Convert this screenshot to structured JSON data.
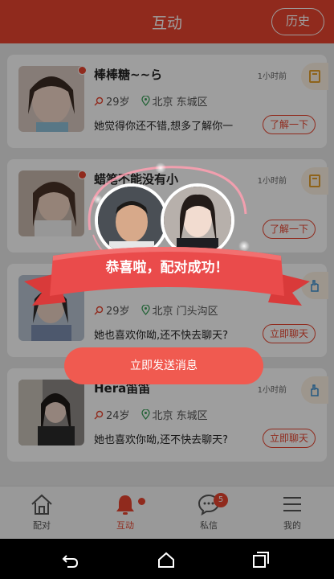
{
  "header": {
    "title": "互动",
    "history_label": "历史"
  },
  "cards": [
    {
      "name": "棒棒糖~~ら",
      "time": "1小时前",
      "age": "29岁",
      "location": "北京 东城区",
      "message": "她觉得你还不错,想多了解你一",
      "action": "了解一下",
      "side_icon": "book-icon"
    },
    {
      "name": "蜡笔不能没有小",
      "time": "1小时前",
      "age": "",
      "location": "",
      "message": "",
      "action": "了解一下",
      "side_icon": "book-icon"
    },
    {
      "name": "",
      "time": "",
      "age": "29岁",
      "location": "北京 门头沟区",
      "message": "她也喜欢你呦,还不快去聊天?",
      "action": "立即聊天",
      "side_icon": "hand-icon"
    },
    {
      "name": "Hera笛笛",
      "time": "1小时前",
      "age": "24岁",
      "location": "北京 东城区",
      "message": "她也喜欢你呦,还不快去聊天?",
      "action": "立即聊天",
      "side_icon": "hand-icon"
    }
  ],
  "popup": {
    "ribbon_text": "恭喜啦，配对成功！",
    "send_label": "立即发送消息"
  },
  "tabs": [
    {
      "label": "配对",
      "icon": "home-icon"
    },
    {
      "label": "互动",
      "icon": "bell-icon"
    },
    {
      "label": "私信",
      "icon": "chat-icon",
      "badge": "5"
    },
    {
      "label": "我的",
      "icon": "menu-icon"
    }
  ],
  "colors": {
    "accent": "#e8452f",
    "button": "#f05a50"
  }
}
